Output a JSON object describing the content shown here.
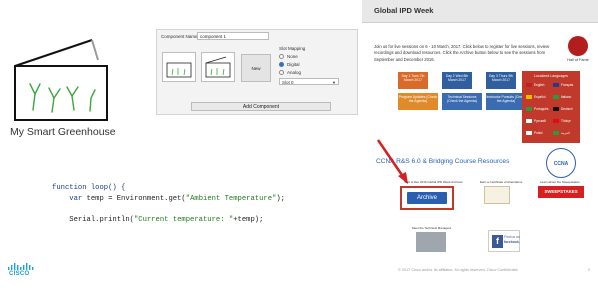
{
  "greenhouse": {
    "title": "My Smart Greenhouse"
  },
  "component_panel": {
    "name_label": "Component Name:",
    "name_value": "component 1",
    "new_label": "New",
    "slot_mapping_title": "Slot Mapping",
    "options": [
      "None",
      "Digital",
      "Analog"
    ],
    "selected_option": "Digital",
    "slot_value": "Slot 0",
    "add_label": "Add Component"
  },
  "code": {
    "line1": "function loop() {",
    "line2_kw": "var",
    "line2_rest": " temp = Environment.get(",
    "line2_str": "\"Ambient Temperature\"",
    "line2_end": ");",
    "line3_fn": "Serial.println(",
    "line3_str": "\"Current temperature: \"",
    "line3_end": "+temp);"
  },
  "cisco": {
    "word": "CISCO"
  },
  "ipd": {
    "title": "Global IPD Week",
    "intro": "Join us for live sessions on 6 - 10 March, 2017. Click below to register for live sessions, review recordings and download resources. Click the Archive button below to see the sessions from September and December 2016.",
    "hall_of_fame": "Hall of Fame",
    "tiles": {
      "day1": "Day 1 Tues 7th March 2017",
      "day2": "Day 2 Wed 8th March 2017",
      "day3": "Day 3 Thurs 9th March 2017",
      "prog": "Program Updates (Check the Agenda)",
      "tech": "Technical Sessions (Check the Agenda)",
      "instr": "Instructor Pursuits (Check the Agenda)"
    },
    "languages_title": "Localized Languages",
    "languages": [
      "English",
      "Français",
      "Español",
      "Italiano",
      "Português",
      "Deutsch",
      "Русский",
      "Türkçe",
      "Polski",
      "العربية"
    ],
    "ccna_link": "CCNA R&S 6.0 & Bridging Course Resources",
    "ccna_badge": "CCNA",
    "archive_caption": "Sept & Dec 2016 Global IPD Week Archives",
    "archive_label": "Archive",
    "cert_caption": "Earn a Certificate of Attendance",
    "sweep_caption": "Learn about the Sweepstakes",
    "sweep_label": "SWEEPSTAKES",
    "mgr_caption": "Meet the Technical Managers",
    "fb_line1": "Find us on",
    "fb_line2": "facebook.",
    "copyright": "© 2017 Cisco and/or its affiliates. All rights reserved. Cisco Confidential",
    "slide_number": "2"
  },
  "colors": {
    "accent_blue": "#2a5fb0",
    "accent_red": "#c0392b",
    "cisco_blue": "#1ba0d7"
  }
}
